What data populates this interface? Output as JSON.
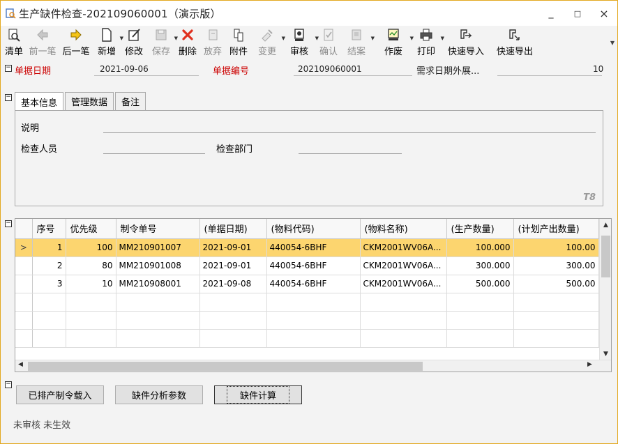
{
  "window": {
    "title": "生产缺件检查-202109060001（演示版）",
    "controls": [
      "_",
      "□",
      "×"
    ]
  },
  "toolbar": {
    "items": [
      {
        "label": "清单",
        "icon": "list-search-icon",
        "enabled": true
      },
      {
        "label": "前一笔",
        "icon": "arrow-left-icon",
        "enabled": false
      },
      {
        "label": "后一笔",
        "icon": "arrow-right-icon",
        "enabled": true
      },
      {
        "label": "新增",
        "icon": "new-document-icon",
        "enabled": true,
        "dropdown": true
      },
      {
        "label": "修改",
        "icon": "edit-icon",
        "enabled": true
      },
      {
        "label": "保存",
        "icon": "save-icon",
        "enabled": false,
        "dropdown": true
      },
      {
        "label": "删除",
        "icon": "delete-icon",
        "enabled": true
      },
      {
        "label": "放弃",
        "icon": "discard-icon",
        "enabled": false
      },
      {
        "label": "附件",
        "icon": "attachment-icon",
        "enabled": true
      },
      {
        "label": "变更",
        "icon": "change-icon",
        "enabled": false,
        "dropdown": true
      },
      {
        "label": "审核",
        "icon": "approve-icon",
        "enabled": true,
        "dropdown": true
      },
      {
        "label": "确认",
        "icon": "confirm-icon",
        "enabled": false
      },
      {
        "label": "结案",
        "icon": "close-case-icon",
        "enabled": false,
        "dropdown": true
      },
      {
        "label": "作废",
        "icon": "void-icon",
        "enabled": true,
        "dropdown": true
      },
      {
        "label": "打印",
        "icon": "print-icon",
        "enabled": true,
        "dropdown": true
      },
      {
        "label": "快速导入",
        "icon": "quick-import-icon",
        "enabled": true
      },
      {
        "label": "快速导出",
        "icon": "quick-export-icon",
        "enabled": true
      }
    ]
  },
  "header": {
    "date_label": "单据日期",
    "date_value": "2021-09-06",
    "number_label": "单据编号",
    "number_value": "202109060001",
    "ext_label": "需求日期外展...",
    "ext_value": "10"
  },
  "tabs": [
    "基本信息",
    "管理数据",
    "备注"
  ],
  "basic": {
    "desc_label": "说明",
    "inspector_label": "检查人员",
    "dept_label": "检查部门",
    "watermark": "T8"
  },
  "grid": {
    "columns": [
      "序号",
      "优先级",
      "制令单号",
      "(单据日期)",
      "(物料代码)",
      "(物料名称)",
      "(生产数量)",
      "(计划产出数量)"
    ],
    "rows": [
      {
        "seq": "1",
        "priority": "100",
        "order_no": "MM210901007",
        "date": "2021-09-01",
        "code": "440054-6BHF",
        "name": "CKM2001WV06A...",
        "qty": "100.000",
        "plan_qty": "100.00"
      },
      {
        "seq": "2",
        "priority": "80",
        "order_no": "MM210901008",
        "date": "2021-09-01",
        "code": "440054-6BHF",
        "name": "CKM2001WV06A...",
        "qty": "300.000",
        "plan_qty": "300.00"
      },
      {
        "seq": "3",
        "priority": "10",
        "order_no": "MM210908001",
        "date": "2021-09-08",
        "code": "440054-6BHF",
        "name": "CKM2001WV06A...",
        "qty": "500.000",
        "plan_qty": "500.00"
      }
    ],
    "current_row_marker": ">"
  },
  "buttons": {
    "load": "已排产制令载入",
    "params": "缺件分析参数",
    "calc": "缺件计算"
  },
  "status": "未审核 未生效",
  "colors": {
    "selected_row": "#fcd56f",
    "required_label": "#cc0000",
    "window_border": "#e3a81e"
  }
}
